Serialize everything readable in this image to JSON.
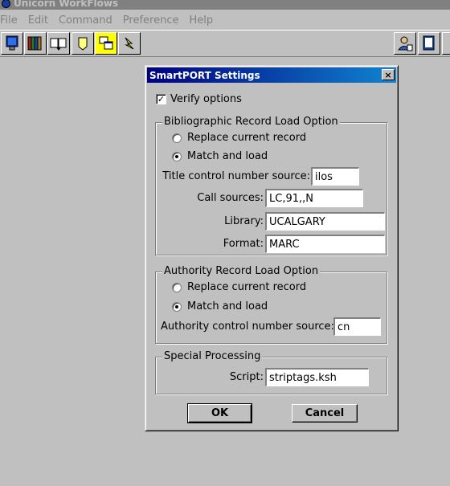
{
  "app": {
    "title": "Unicorn WorkFlows",
    "menus": [
      "File",
      "Edit",
      "Command",
      "Preference",
      "Help"
    ],
    "toolbar_icons": [
      "screen-icon",
      "books-icon",
      "open-book-icon",
      "note-icon",
      "windows-icon",
      "wizard-icon",
      "user-icon",
      "document-icon"
    ]
  },
  "dialog": {
    "title": "SmartPORT Settings",
    "close": "×",
    "verify_options": {
      "label": "Verify options",
      "checked": true,
      "mark": "✓"
    },
    "bib": {
      "title": "Bibliographic Record Load Option",
      "replace": "Replace current record",
      "match": "Match and load",
      "selected": "match",
      "title_control_label": "Title control number source:",
      "title_control_value": "ilos",
      "call_sources_label": "Call sources:",
      "call_sources_value": "LC,91,,N",
      "library_label": "Library:",
      "library_value": "UCALGARY",
      "format_label": "Format:",
      "format_value": "MARC"
    },
    "auth": {
      "title": "Authority Record Load Option",
      "replace": "Replace current record",
      "match": "Match and load",
      "selected": "match",
      "control_label": "Authority control number source:",
      "control_value": "cn"
    },
    "special": {
      "title": "Special Processing",
      "script_label": "Script:",
      "script_value": "striptags.ksh"
    },
    "ok": "OK",
    "cancel": "Cancel"
  }
}
